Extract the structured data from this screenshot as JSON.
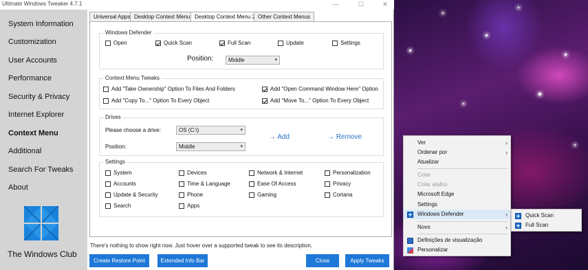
{
  "window": {
    "title": "Ultimate Windows Tweaker 4.7.1",
    "controls": [
      "—",
      "☐",
      "✕"
    ]
  },
  "sidebar": {
    "items": [
      {
        "label": "System Information"
      },
      {
        "label": "Customization"
      },
      {
        "label": "User Accounts"
      },
      {
        "label": "Performance"
      },
      {
        "label": "Security & Privacy"
      },
      {
        "label": "Internet Explorer"
      },
      {
        "label": "Context Menu",
        "active": true
      },
      {
        "label": "Additional"
      },
      {
        "label": "Search For Tweaks"
      },
      {
        "label": "About"
      }
    ],
    "brand": "The Windows Club"
  },
  "tabs": [
    {
      "label": "Universal Apps"
    },
    {
      "label": "Desktop Context Menu"
    },
    {
      "label": "Desktop Context Menu 2",
      "active": true
    },
    {
      "label": "Other Context Menus"
    }
  ],
  "defender": {
    "title": "Windows Defender",
    "options": [
      {
        "label": "Open",
        "checked": false
      },
      {
        "label": "Quick Scan",
        "checked": true
      },
      {
        "label": "Full Scan",
        "checked": true
      },
      {
        "label": "Update",
        "checked": false
      },
      {
        "label": "Settings",
        "checked": false
      }
    ],
    "position_label": "Position:",
    "position_value": "Middle"
  },
  "tweaks": {
    "title": "Context Menu Tweaks",
    "options": [
      {
        "label": "Add \"Take Ownership\" Option To Files And Folders",
        "checked": false
      },
      {
        "label": "Add \"Open Command Window Here\" Option",
        "checked": true
      },
      {
        "label": "Add \"Copy To...\" Option To Every Object",
        "checked": false
      },
      {
        "label": "Add \"Move To...\" Option To Every Object",
        "checked": true
      }
    ]
  },
  "drives": {
    "title": "Drives",
    "drive_label": "Please choose a drive:",
    "drive_value": "OS (C:\\)",
    "position_label": "Position:",
    "position_value": "Middle",
    "add": "Add",
    "remove": "Remove"
  },
  "settings": {
    "title": "Settings",
    "options": [
      {
        "label": "System"
      },
      {
        "label": "Devices"
      },
      {
        "label": "Network & Internet"
      },
      {
        "label": "Personalization"
      },
      {
        "label": "Accounts"
      },
      {
        "label": "Time & Language"
      },
      {
        "label": "Ease Of Access"
      },
      {
        "label": "Privacy"
      },
      {
        "label": "Update & Security"
      },
      {
        "label": "Phone"
      },
      {
        "label": "Gaming"
      },
      {
        "label": "Cortana"
      },
      {
        "label": "Search"
      },
      {
        "label": "Apps"
      }
    ]
  },
  "hint": "There's nothing to show right now. Just hover over a supported tweak to see its description.",
  "buttons": {
    "restore": "Create Restore Point",
    "info": "Extended Info Bar",
    "close": "Close",
    "apply": "Apply Tweaks"
  },
  "context_menu": {
    "items": [
      {
        "label": "Ver",
        "submenu": true
      },
      {
        "label": "Ordenar por",
        "submenu": true
      },
      {
        "label": "Atualizar"
      },
      {
        "label": "Colar",
        "disabled": true
      },
      {
        "label": "Colar atalho",
        "disabled": true
      },
      {
        "label": "Microsoft Edge"
      },
      {
        "label": "Settings"
      },
      {
        "label": "Windows Defender",
        "submenu": true,
        "highlight": true,
        "icon": "windows-defender-icon"
      },
      {
        "label": "Novo",
        "submenu": true
      },
      {
        "label": "Definições de visualização",
        "icon": "display-settings-icon"
      },
      {
        "label": "Personalizar",
        "icon": "personalize-icon"
      }
    ],
    "submenu": [
      {
        "label": "Quick Scan",
        "icon": "windows-defender-icon"
      },
      {
        "label": "Full Scan",
        "icon": "windows-defender-icon"
      }
    ]
  },
  "colors": {
    "sidebar_bg": "#d4d4d4",
    "accent": "#1e78d7",
    "link": "#2b6fc4",
    "menu_bg": "#f2f2f2"
  }
}
